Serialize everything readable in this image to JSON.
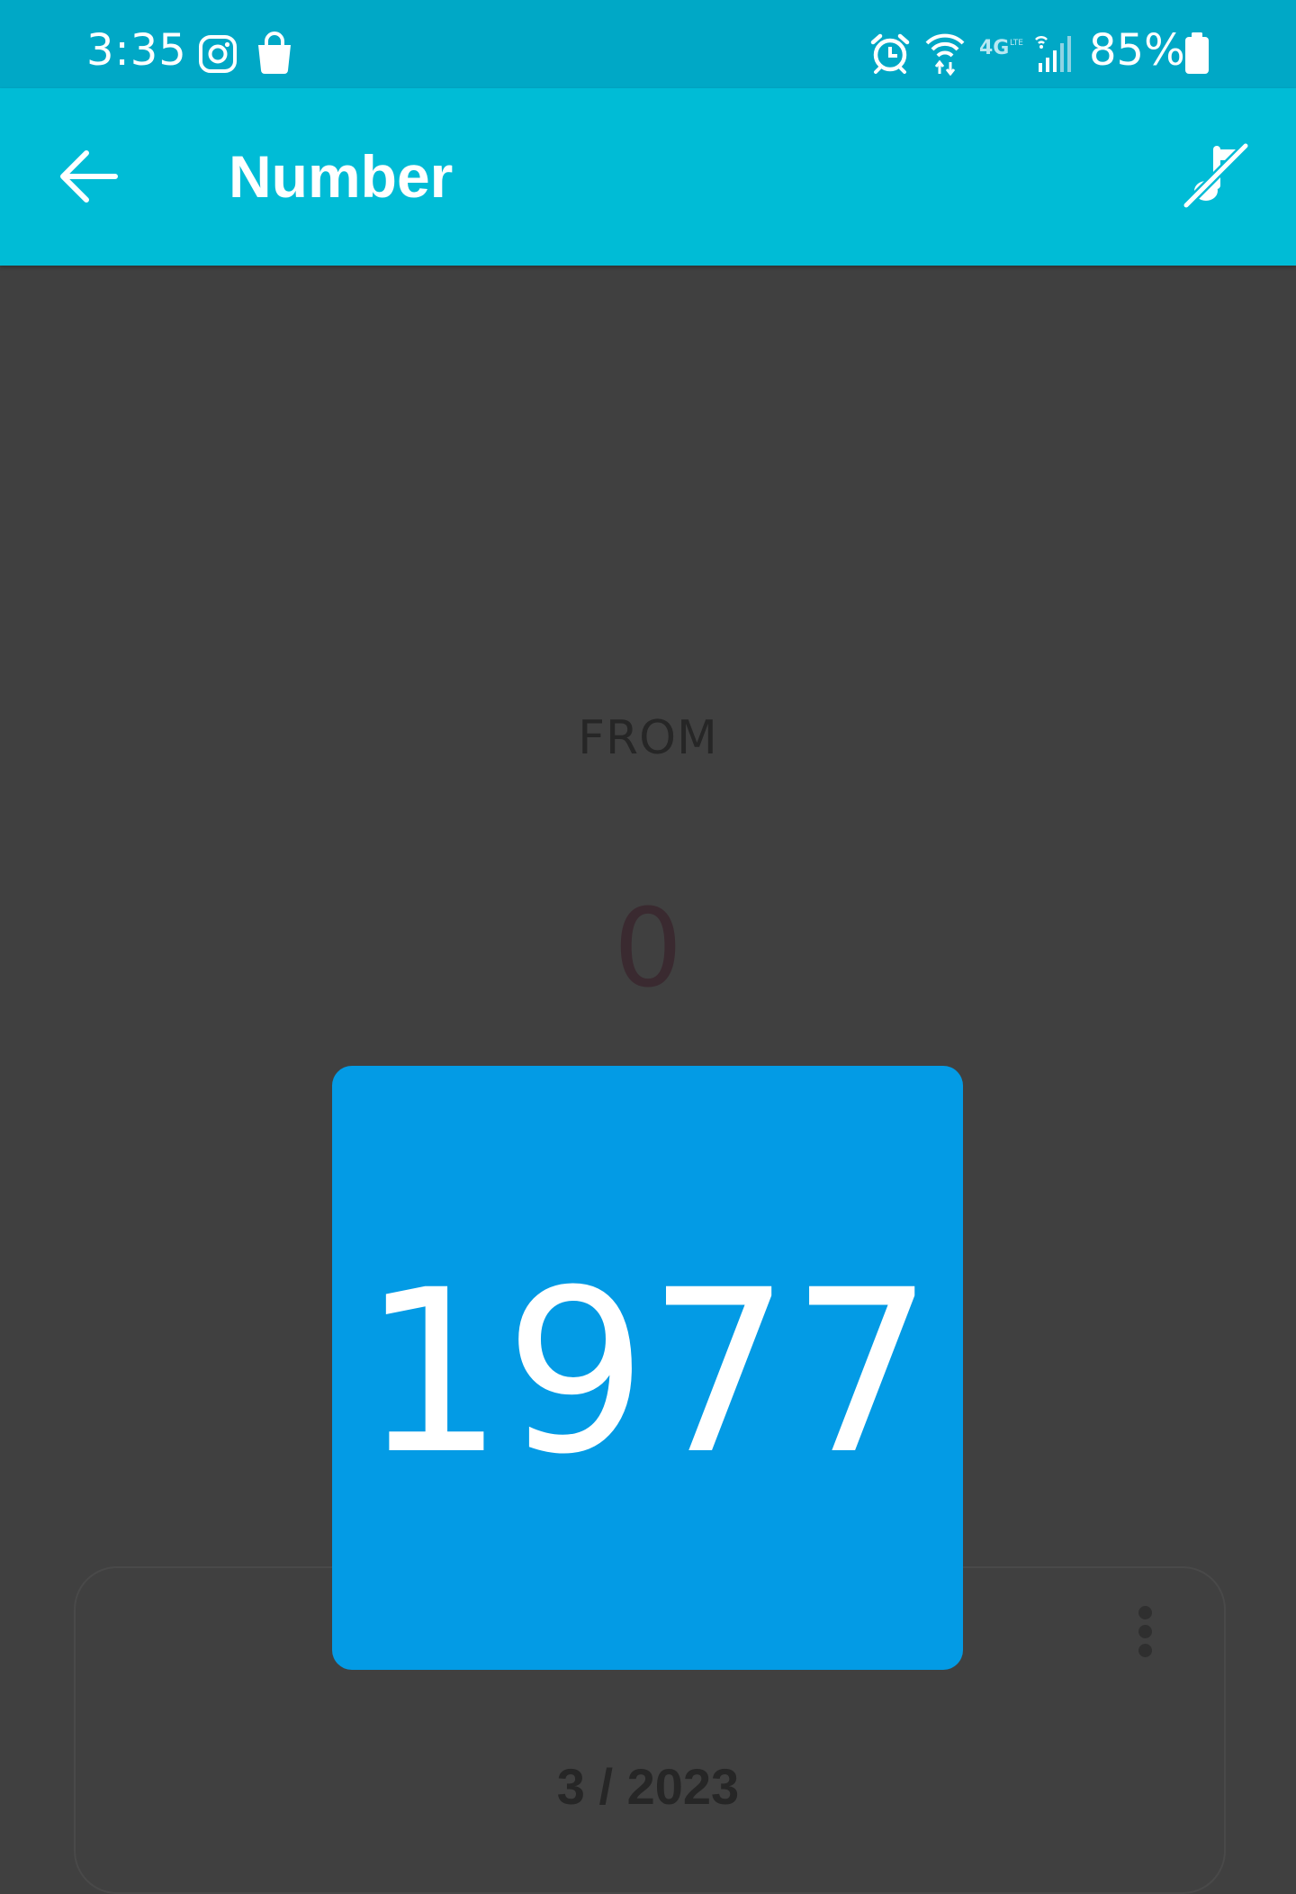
{
  "status_bar": {
    "time": "3:35",
    "battery": "85%",
    "icons": [
      "instagram-icon",
      "shopping-bag-icon",
      "alarm-icon",
      "wifi-icon",
      "4g-lte-icon",
      "signal-icon",
      "battery-icon"
    ]
  },
  "app_bar": {
    "title": "Number",
    "back_icon": "arrow-back-icon",
    "action_icon": "music-off-icon",
    "color": "#00BCD6"
  },
  "main": {
    "from_label": "FROM",
    "from_value": "0",
    "number": "1977",
    "number_card_color": "#039BE5",
    "date": "3 / 2023"
  },
  "colors": {
    "status_bar": "#00A8C6",
    "background": "#404040"
  }
}
